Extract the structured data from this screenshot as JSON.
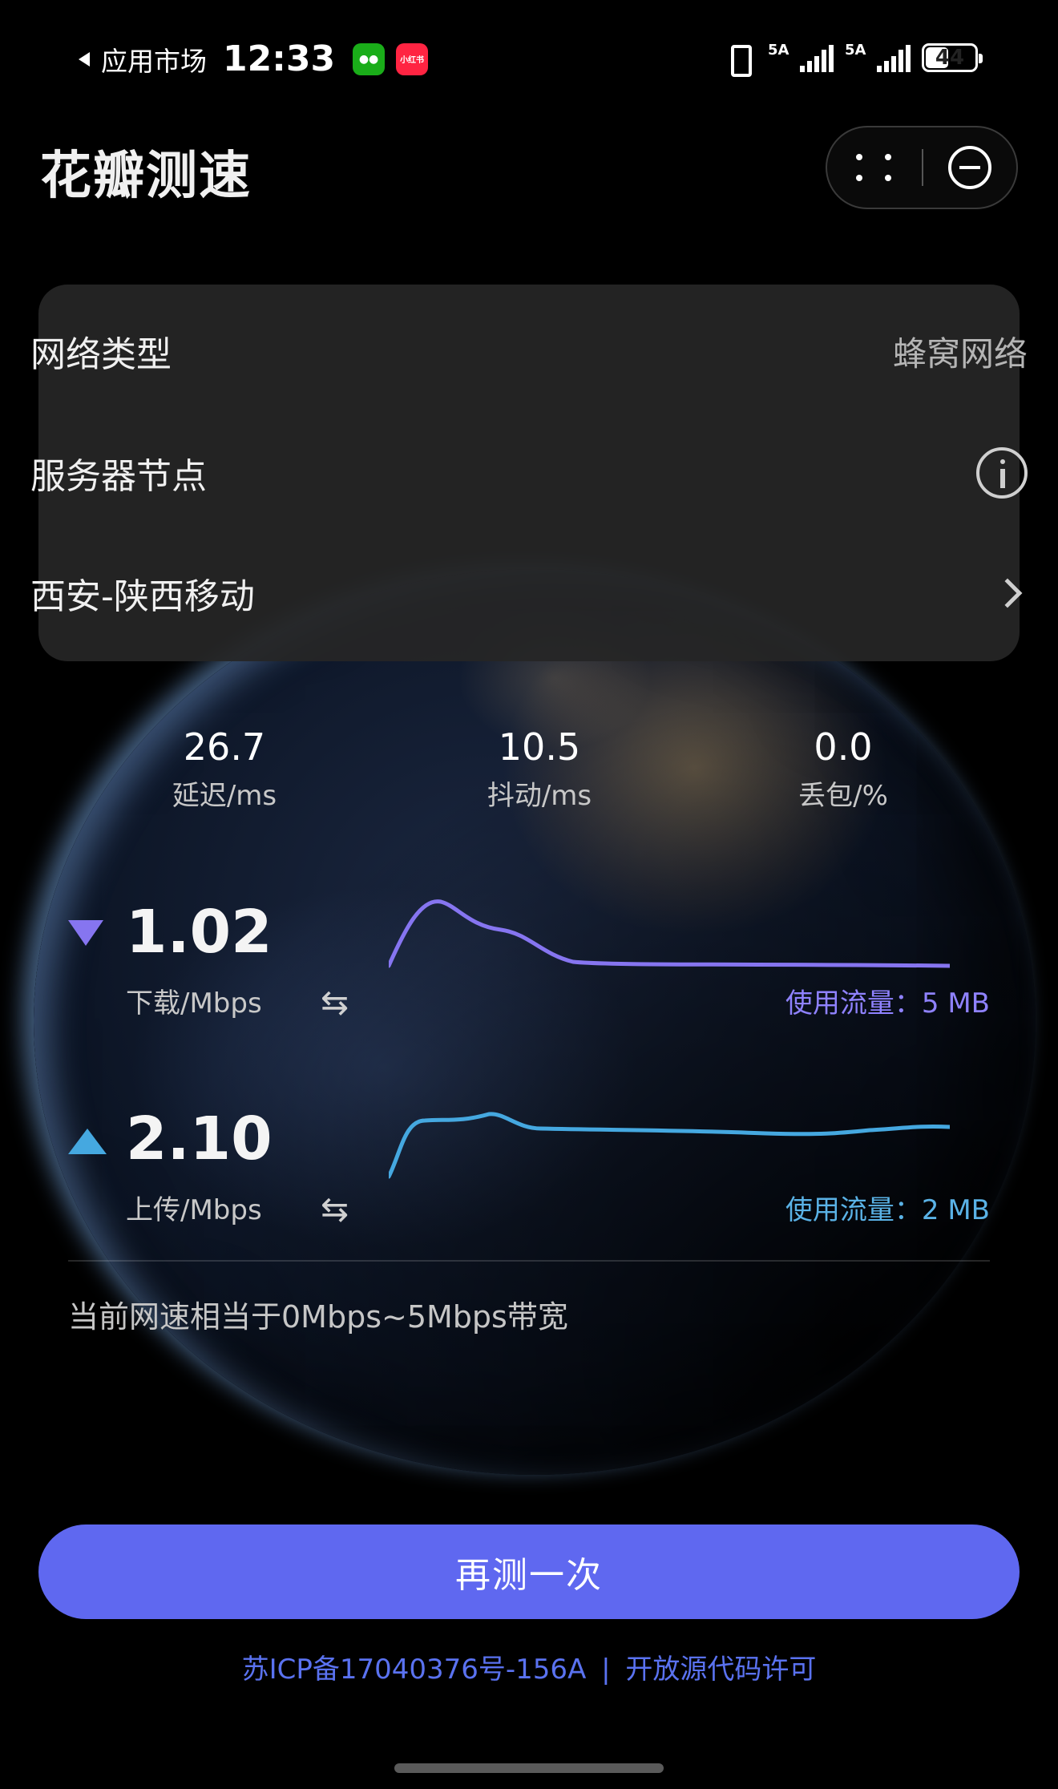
{
  "status_bar": {
    "back_app": "应用市场",
    "time": "12:33",
    "wechat_icon": "wechat-icon",
    "xiaohongshu_badge": "小红书",
    "signal1_label": "5A",
    "signal2_label": "5A",
    "battery": "44"
  },
  "header": {
    "title": "花瓣测速"
  },
  "info": {
    "network_type_label": "网络类型",
    "network_type_value": "蜂窝网络",
    "server_label": "服务器节点",
    "server_value": "西安-陕西移动"
  },
  "metrics": {
    "latency_value": "26.7",
    "latency_unit": "延迟/ms",
    "jitter_value": "10.5",
    "jitter_unit": "抖动/ms",
    "loss_value": "0.0",
    "loss_unit": "丢包/%"
  },
  "download": {
    "value": "1.02",
    "unit": "下载/Mbps",
    "usage": "使用流量：5 MB",
    "color": "#8675f0"
  },
  "upload": {
    "value": "2.10",
    "unit": "上传/Mbps",
    "usage": "使用流量：2 MB",
    "color": "#45a8e0"
  },
  "bandwidth_text": "当前网速相当于0Mbps~5Mbps带宽",
  "retest_label": "再测一次",
  "footer": {
    "icp": "苏ICP备17040376号-156A",
    "separator": "|",
    "license": "开放源代码许可"
  }
}
